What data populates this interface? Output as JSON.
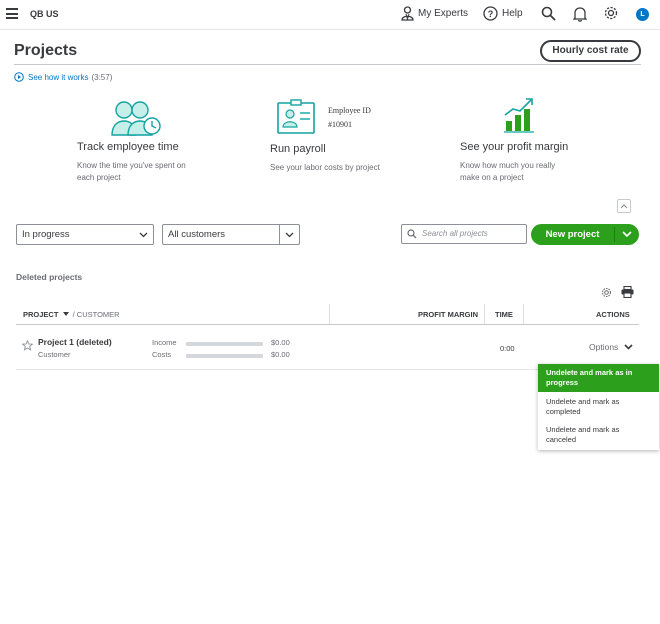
{
  "topbar": {
    "company": "QB US",
    "my_experts": "My Experts",
    "help": "Help",
    "avatar_initial": "L"
  },
  "header": {
    "title": "Projects",
    "hourly_cost_rate": "Hourly cost rate",
    "see_how": "See how it works",
    "duration": "(3:57)"
  },
  "features": [
    {
      "title": "Track employee time",
      "desc_line1": "Know the time you've spent on",
      "desc_line2": "each project",
      "icon": "people-clock-icon"
    },
    {
      "title": "Run payroll",
      "desc_line1": "See your labor costs by project",
      "desc_line2": "",
      "icon": "employee-id-badge-icon",
      "badge_line1": "Employee ID",
      "badge_line2": "#10901"
    },
    {
      "title": "See your profit margin",
      "desc_line1": "Know how much you really",
      "desc_line2": "make on a project",
      "icon": "growth-chart-icon"
    }
  ],
  "filters": {
    "status_value": "In progress",
    "customer_value": "All customers",
    "search_placeholder": "Search all projects",
    "new_project": "New project"
  },
  "section": {
    "label": "Deleted projects"
  },
  "table": {
    "headers": {
      "project": "PROJECT",
      "customer": "/ CUSTOMER",
      "profit_margin": "PROFIT MARGIN",
      "time": "TIME",
      "actions": "ACTIONS"
    },
    "rows": [
      {
        "name": "Project 1 (deleted)",
        "customer": "Customer",
        "income_label": "Income",
        "income_value": "$0.00",
        "costs_label": "Costs",
        "costs_value": "$0.00",
        "time": "0:00",
        "options": "Options"
      }
    ]
  },
  "menu": {
    "items": [
      {
        "line1": "Undelete and mark as in",
        "line2": "progress"
      },
      {
        "line1": "Undelete and mark as",
        "line2": "completed"
      },
      {
        "line1": "Undelete and mark as",
        "line2": "canceled"
      }
    ]
  },
  "colors": {
    "accent_green": "#2ca01c",
    "link_blue": "#0077c5",
    "teal_icon": "#13a3a1",
    "text": "#393a3d"
  }
}
